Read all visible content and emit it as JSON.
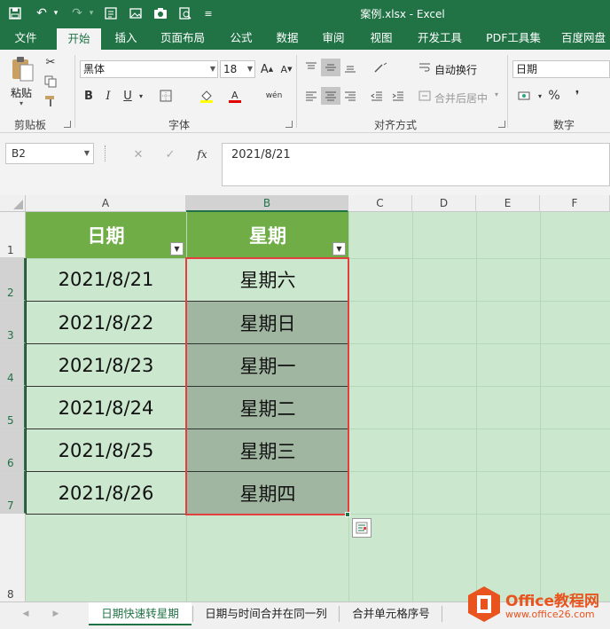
{
  "window": {
    "title": "案例.xlsx - Excel"
  },
  "quick_access": [
    "save-icon",
    "undo-icon",
    "redo-icon",
    "form-icon",
    "image-icon",
    "camera-icon",
    "print-preview-icon",
    "customize-icon"
  ],
  "tabs": [
    {
      "label": "文件"
    },
    {
      "label": "开始"
    },
    {
      "label": "插入"
    },
    {
      "label": "页面布局"
    },
    {
      "label": "公式"
    },
    {
      "label": "数据"
    },
    {
      "label": "审阅"
    },
    {
      "label": "视图"
    },
    {
      "label": "开发工具"
    },
    {
      "label": "PDF工具集"
    },
    {
      "label": "百度网盘"
    }
  ],
  "ribbon": {
    "clipboard": {
      "paste_label": "粘贴",
      "group_label": "剪贴板"
    },
    "font": {
      "name": "黑体",
      "size": "18",
      "group_label": "字体",
      "bold": "B",
      "italic": "I",
      "underline": "U",
      "phonetic": "wén"
    },
    "alignment": {
      "wrap_text": "自动换行",
      "merge_center": "合并后居中",
      "group_label": "对齐方式"
    },
    "number": {
      "format": "日期",
      "group_label": "数字",
      "percent": "%"
    },
    "accent": "#217346"
  },
  "formula_bar": {
    "name_box": "B2",
    "fx": "fx",
    "formula": "2021/8/21"
  },
  "grid": {
    "columns": [
      "A",
      "B",
      "C",
      "D",
      "E",
      "F"
    ],
    "rows": [
      "1",
      "2",
      "3",
      "4",
      "5",
      "6",
      "7",
      "8"
    ],
    "header": {
      "a": "日期",
      "b": "星期"
    },
    "data": [
      {
        "date": "2021/8/21",
        "weekday": "星期六"
      },
      {
        "date": "2021/8/22",
        "weekday": "星期日"
      },
      {
        "date": "2021/8/23",
        "weekday": "星期一"
      },
      {
        "date": "2021/8/24",
        "weekday": "星期二"
      },
      {
        "date": "2021/8/25",
        "weekday": "星期三"
      },
      {
        "date": "2021/8/26",
        "weekday": "星期四"
      }
    ],
    "selection_color": "#e2403f",
    "header_color": "#70ad47"
  },
  "sheets": [
    {
      "label": "日期快速转星期"
    },
    {
      "label": "日期与时间合并在同一列"
    },
    {
      "label": "合并单元格序号"
    }
  ],
  "watermark": {
    "brand": "Office教程网",
    "url": "www.office26.com"
  }
}
